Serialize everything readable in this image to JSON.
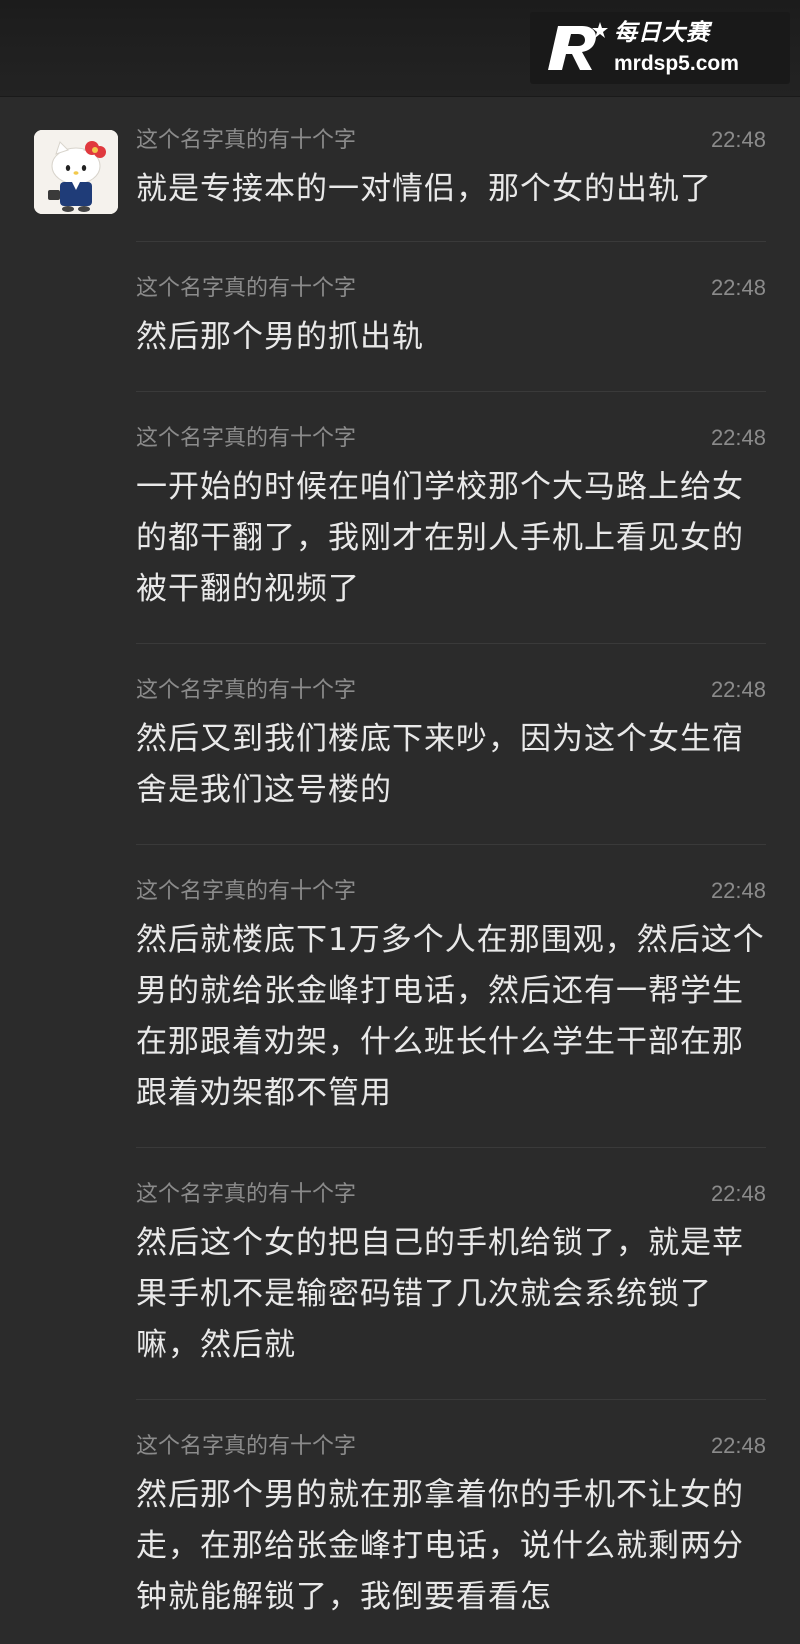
{
  "watermark": {
    "title": "每日大赛",
    "url": "mrdsp5.com"
  },
  "icons": {
    "avatar": "hello-kitty-avatar",
    "logo": "r-star-logo"
  },
  "messages": [
    {
      "sender": "这个名字真的有十个字",
      "time": "22:48",
      "text": "就是专接本的一对情侣，那个女的出轨了"
    },
    {
      "sender": "这个名字真的有十个字",
      "time": "22:48",
      "text": "然后那个男的抓出轨"
    },
    {
      "sender": "这个名字真的有十个字",
      "time": "22:48",
      "text": "一开始的时候在咱们学校那个大马路上给女的都干翻了，我刚才在别人手机上看见女的被干翻的视频了"
    },
    {
      "sender": "这个名字真的有十个字",
      "time": "22:48",
      "text": "然后又到我们楼底下来吵，因为这个女生宿舍是我们这号楼的"
    },
    {
      "sender": "这个名字真的有十个字",
      "time": "22:48",
      "text": "然后就楼底下1万多个人在那围观，然后这个男的就给张金峰打电话，然后还有一帮学生在那跟着劝架，什么班长什么学生干部在那跟着劝架都不管用"
    },
    {
      "sender": "这个名字真的有十个字",
      "time": "22:48",
      "text": "然后这个女的把自己的手机给锁了，就是苹果手机不是输密码错了几次就会系统锁了嘛，然后就"
    },
    {
      "sender": "这个名字真的有十个字",
      "time": "22:48",
      "text": "然后那个男的就在那拿着你的手机不让女的走，在那给张金峰打电话，说什么就剩两分钟就能解锁了，我倒要看看怎"
    }
  ]
}
